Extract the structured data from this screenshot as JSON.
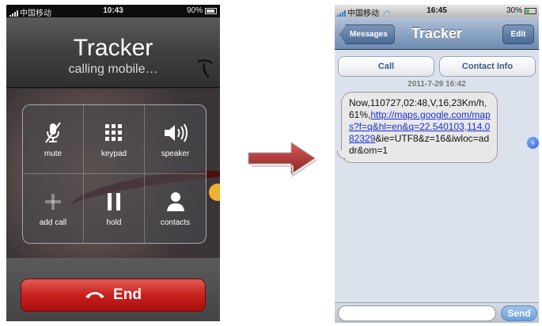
{
  "call_screen": {
    "status_bar": {
      "carrier": "中国移动",
      "time": "10:43",
      "battery": "90%"
    },
    "contact_name": "Tracker",
    "call_status": "calling mobile…",
    "buttons": [
      {
        "label": "mute",
        "icon": "microphone-mute-icon"
      },
      {
        "label": "keypad",
        "icon": "keypad-icon"
      },
      {
        "label": "speaker",
        "icon": "speaker-icon"
      },
      {
        "label": "add call",
        "icon": "plus-icon"
      },
      {
        "label": "hold",
        "icon": "pause-icon"
      },
      {
        "label": "contacts",
        "icon": "person-icon"
      }
    ],
    "end_button_label": "End"
  },
  "message_screen": {
    "status_bar": {
      "carrier": "中国移动",
      "time": "16:45",
      "battery": "30%"
    },
    "nav": {
      "back_label": "Messages",
      "title": "Tracker",
      "edit_label": "Edit"
    },
    "actions": {
      "call_label": "Call",
      "contact_info_label": "Contact Info"
    },
    "timestamp": "2011-7-29 16:42",
    "message": {
      "prefix": "Now,110727,02:48,V,16,23Km/h,61%,",
      "link": "http://maps.google.com/maps?f=q&hl=en&q=22.540103,114.082329",
      "suffix": "&ie=UTF8&z=16&iwloc=addr&om=1"
    },
    "send_label": "Send"
  },
  "colors": {
    "arrow": "#b83a38",
    "end_button": "#c8201e",
    "link": "#1a2fd6",
    "nav_bar": "#8ea5c4"
  }
}
